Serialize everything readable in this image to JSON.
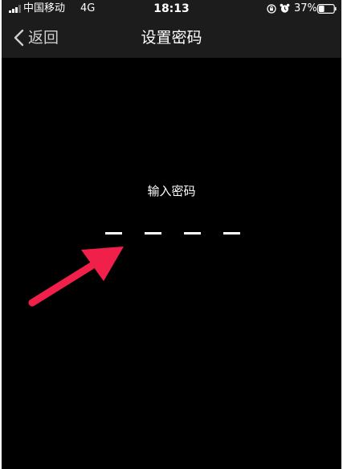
{
  "status_bar": {
    "carrier": "中国移动",
    "network": "4G",
    "time": "18:13",
    "battery": "37%",
    "battery_level": 0.37,
    "signal_bars": 4,
    "signal_bars_active": 3
  },
  "nav": {
    "back_label": "返回",
    "title": "设置密码"
  },
  "main": {
    "prompt": "输入密码",
    "pin_length": 4
  },
  "colors": {
    "background": "#000000",
    "bar_background": "#1c1c1c",
    "text": "#ffffff",
    "annotation_arrow": "#f0204a"
  },
  "icons": {
    "back": "chevron-left-icon",
    "orientation_lock": "orientation-lock-icon",
    "alarm": "alarm-clock-icon",
    "battery": "battery-icon",
    "signal": "cell-signal-icon"
  }
}
